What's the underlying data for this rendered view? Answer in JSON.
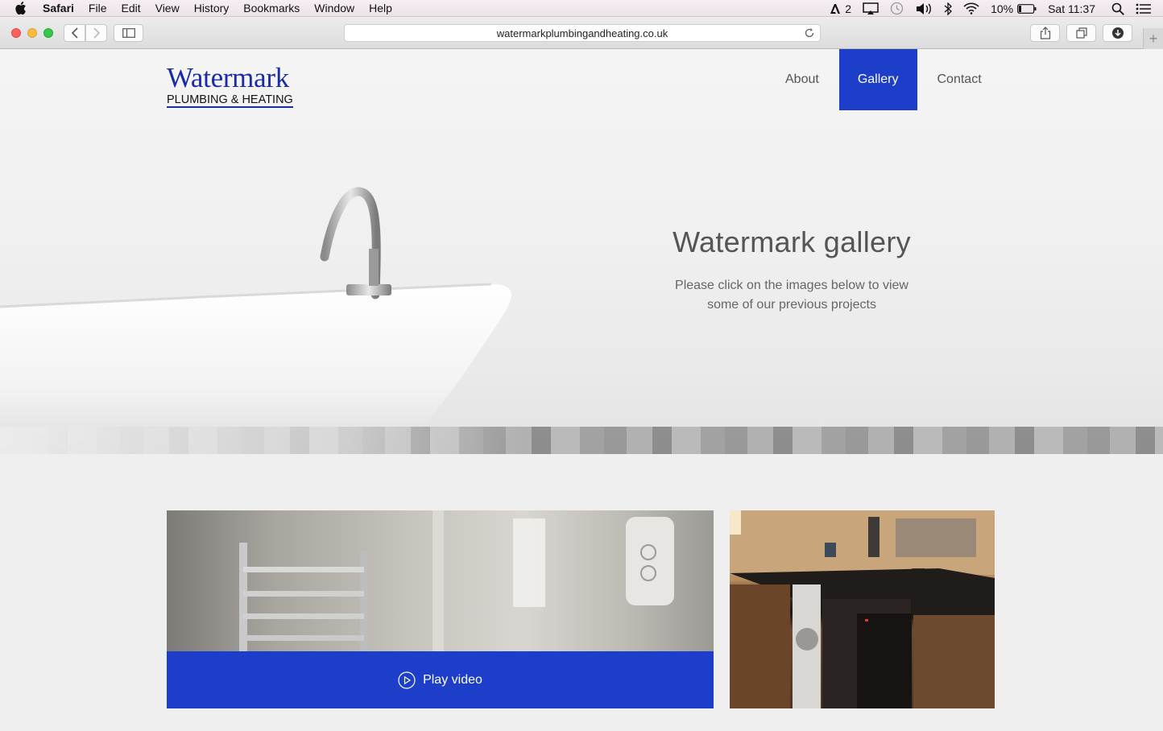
{
  "menubar": {
    "app": "Safari",
    "items": [
      "File",
      "Edit",
      "View",
      "History",
      "Bookmarks",
      "Window",
      "Help"
    ],
    "adobe_count": "2",
    "battery": "10%",
    "time": "Sat 11:37"
  },
  "browser": {
    "url": "watermarkplumbingandheating.co.uk"
  },
  "site": {
    "logo_main": "Watermark",
    "logo_sub": "PLUMBING & HEATING",
    "nav": [
      {
        "label": "About",
        "active": false
      },
      {
        "label": "Gallery",
        "active": true
      },
      {
        "label": "Contact",
        "active": false
      }
    ],
    "hero_title": "Watermark gallery",
    "hero_text_line1": "Please click on the images below to view",
    "hero_text_line2": "some of our previous projects",
    "play_label": "Play video"
  },
  "colors": {
    "brand_blue": "#1d3ec8",
    "logo_blue": "#1a2ba8"
  }
}
